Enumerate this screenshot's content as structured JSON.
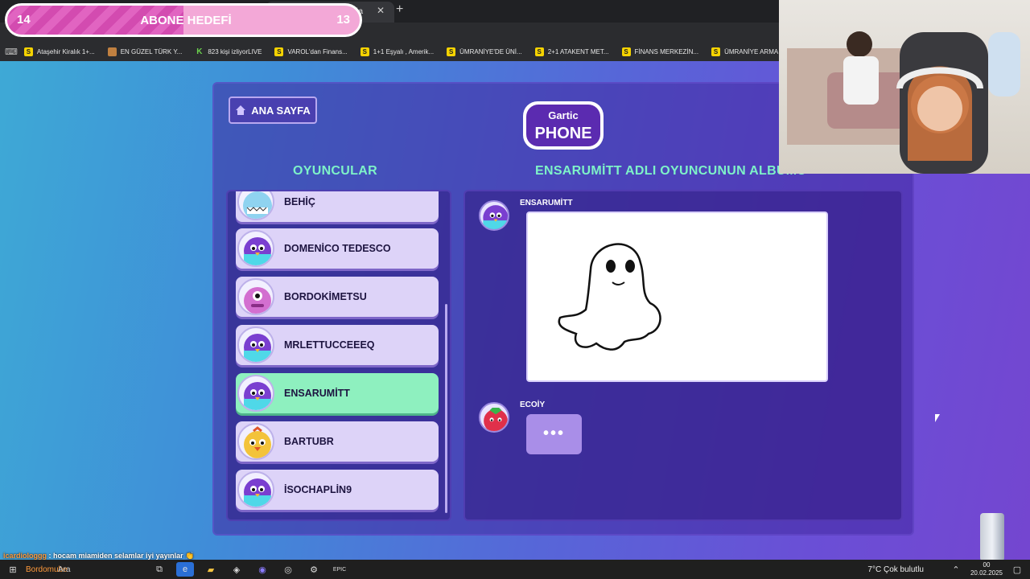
{
  "browser": {
    "tab_fragment": "ğa",
    "bookmarks": [
      {
        "icon": "S",
        "label": "Ataşehir Kiralık 1+..."
      },
      {
        "icon": "flag",
        "label": "EN GÜZEL TÜRK Y..."
      },
      {
        "icon": "K",
        "label": "823 kişi izliyorLIVE"
      },
      {
        "icon": "S",
        "label": "VAROL'dan Finans..."
      },
      {
        "icon": "S",
        "label": "1+1 Eşyalı , Amerik..."
      },
      {
        "icon": "S",
        "label": "ÜMRANİYE'DE ÜNİ..."
      },
      {
        "icon": "S",
        "label": "2+1 ATAKENT MET..."
      },
      {
        "icon": "S",
        "label": "FİNANS MERKEZİN..."
      },
      {
        "icon": "S",
        "label": "ÜMRANİYE ARMA..."
      }
    ]
  },
  "goal": {
    "left": "14",
    "title": "ABONE HEDEFİ",
    "right": "13",
    "progress": 0.5
  },
  "game": {
    "home_label": "ANA SAYFA",
    "logo_top": "Gartic",
    "logo_main": "PHONE",
    "players_header": "OYUNCULAR",
    "album_header": "ENSARUMİTT ADLI OYUNCUNUN ALBÜMÜ",
    "players": [
      {
        "name": "BEHİÇ",
        "active": false,
        "avatar": "blue-monster"
      },
      {
        "name": "DOMENİCO TEDESCO",
        "active": false,
        "avatar": "purple-bird"
      },
      {
        "name": "BORDOKİMETSU",
        "active": false,
        "avatar": "pink-cyclops"
      },
      {
        "name": "MRLETTUCCEEEQ",
        "active": false,
        "avatar": "purple-bird"
      },
      {
        "name": "ENSARUMİTT",
        "active": true,
        "avatar": "purple-bird"
      },
      {
        "name": "BARTUBR",
        "active": false,
        "avatar": "yellow-chick"
      },
      {
        "name": "İSOCHAPLİN9",
        "active": false,
        "avatar": "purple-bird"
      }
    ],
    "album": [
      {
        "user": "ENSARUMİTT",
        "content": "drawing-ghost"
      },
      {
        "user": "ECOİY",
        "content": "typing",
        "typing_text": "•••"
      }
    ]
  },
  "chat": {
    "user": "icardiologgg",
    "message": ": hocam miamiden selamlar iyi yayınlar 👏",
    "second_user": "Bordomube"
  },
  "taskbar": {
    "search": "Ara",
    "weather": "7°C  Çok bulutlu",
    "time": "00",
    "date": "20.02.2025"
  },
  "colors": {
    "accent_green": "#7ef2c8",
    "active_row": "#8ef0bf",
    "goal_pink": "#f3a8d7"
  }
}
